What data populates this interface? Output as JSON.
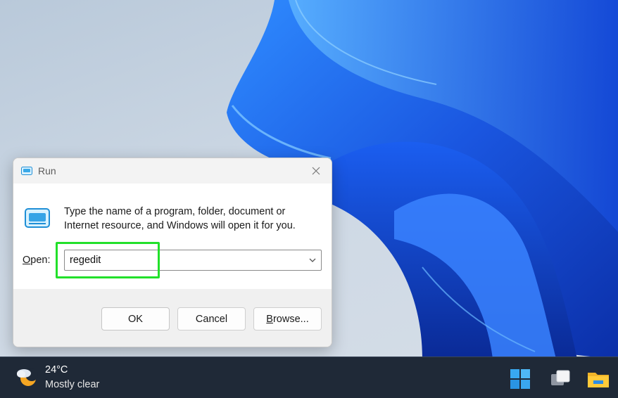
{
  "dialog": {
    "title": "Run",
    "description": "Type the name of a program, folder, document or Internet resource, and Windows will open it for you.",
    "open_label_underlined": "O",
    "open_label_rest": "pen:",
    "input_value": "regedit",
    "buttons": {
      "ok": "OK",
      "cancel": "Cancel",
      "browse_underlined": "B",
      "browse_rest": "rowse..."
    }
  },
  "taskbar": {
    "weather": {
      "temperature": "24°C",
      "condition": "Mostly clear"
    }
  },
  "colors": {
    "highlight": "#22e02a",
    "taskbar": "#1f2937",
    "wallpaper_blue": "#1f5fe8"
  },
  "icons": [
    "run-icon",
    "close-icon",
    "chevron-down-icon",
    "weather-icon",
    "windows-start-icon",
    "task-view-icon",
    "file-explorer-icon"
  ]
}
